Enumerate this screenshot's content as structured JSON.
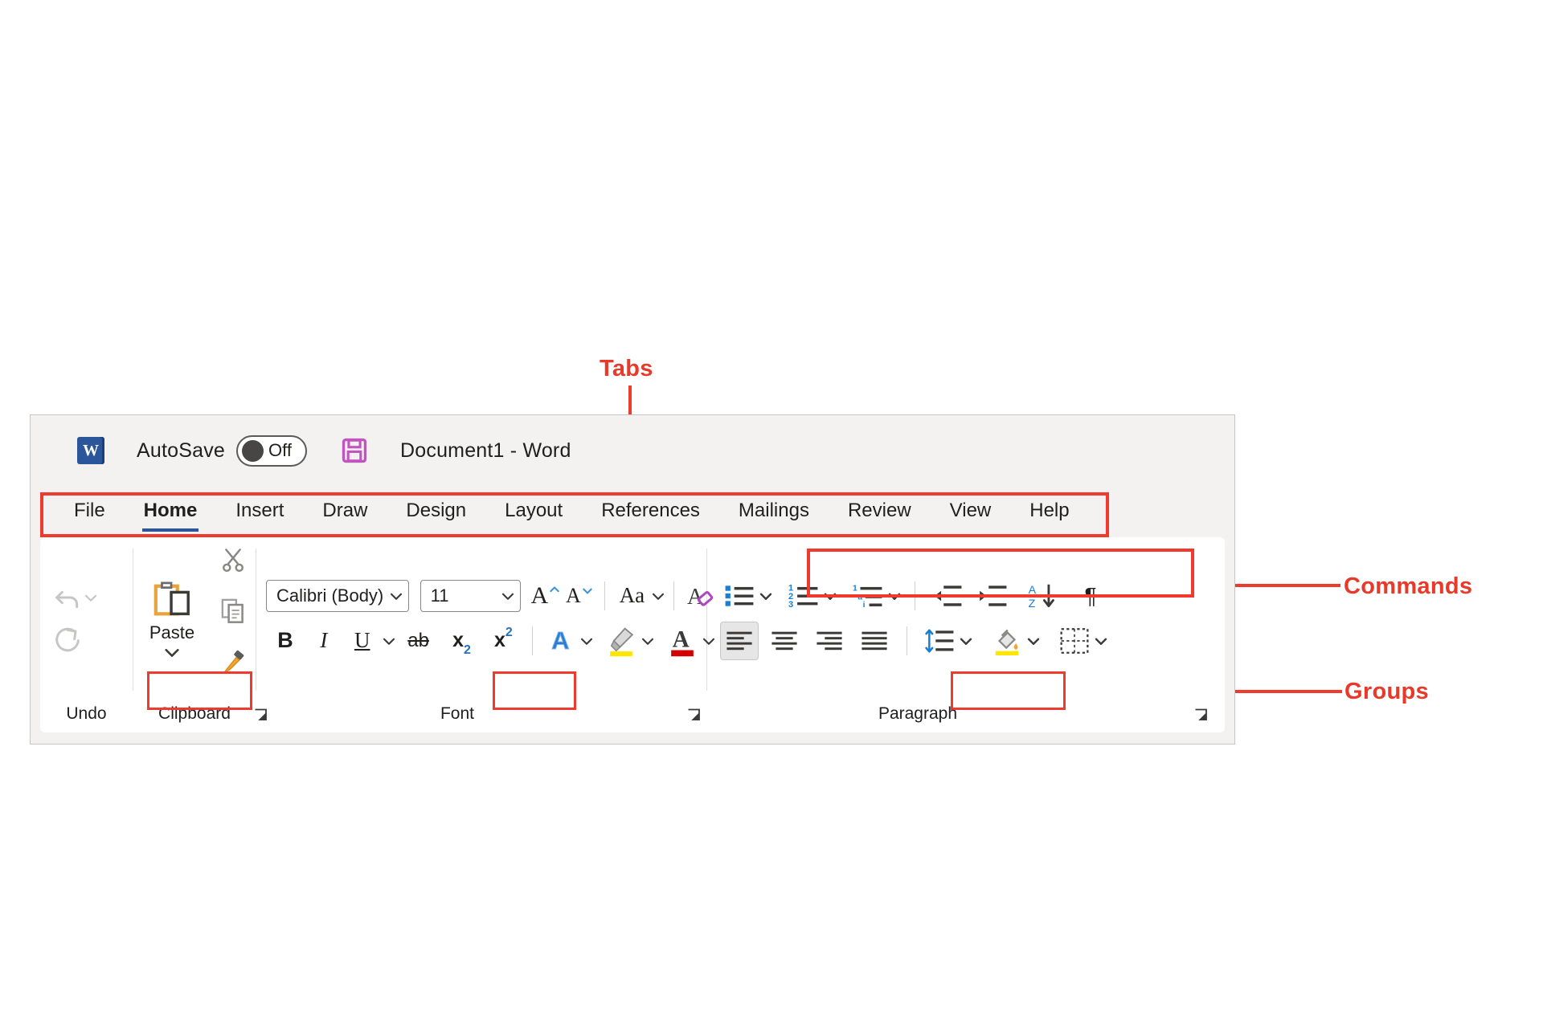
{
  "annotations": {
    "tabs_label": "Tabs",
    "commands_label": "Commands",
    "groups_label": "Groups",
    "accent_color": "#f03a2e"
  },
  "titlebar": {
    "app_icon": "word-logo-icon",
    "autosave_label": "AutoSave",
    "autosave_state": "Off",
    "save_icon": "save-floppy-icon",
    "document_title": "Document1  -  Word"
  },
  "tabs": [
    {
      "label": "File",
      "active": false
    },
    {
      "label": "Home",
      "active": true
    },
    {
      "label": "Insert",
      "active": false
    },
    {
      "label": "Draw",
      "active": false
    },
    {
      "label": "Design",
      "active": false
    },
    {
      "label": "Layout",
      "active": false
    },
    {
      "label": "References",
      "active": false
    },
    {
      "label": "Mailings",
      "active": false
    },
    {
      "label": "Review",
      "active": false
    },
    {
      "label": "View",
      "active": false
    },
    {
      "label": "Help",
      "active": false
    }
  ],
  "groups": {
    "undo": {
      "label": "Undo",
      "commands": [
        {
          "name": "undo-button",
          "icon": "undo-arrow-icon",
          "has_dropdown": true
        },
        {
          "name": "redo-button",
          "icon": "redo-arrow-icon",
          "has_dropdown": false
        }
      ]
    },
    "clipboard": {
      "label": "Clipboard",
      "paste_label": "Paste",
      "commands": [
        {
          "name": "paste-button",
          "icon": "clipboard-paste-icon",
          "has_dropdown": true
        },
        {
          "name": "cut-button",
          "icon": "scissors-icon"
        },
        {
          "name": "copy-button",
          "icon": "copy-pages-icon"
        },
        {
          "name": "format-painter-button",
          "icon": "paintbrush-icon"
        }
      ],
      "has_dialog_launcher": true
    },
    "font": {
      "label": "Font",
      "font_name": "Calibri (Body)",
      "font_size": "11",
      "commands": [
        {
          "name": "grow-font-button",
          "icon": "increase-font-size-icon",
          "glyph": "A"
        },
        {
          "name": "shrink-font-button",
          "icon": "decrease-font-size-icon",
          "glyph": "A"
        },
        {
          "name": "change-case-button",
          "icon": "change-case-icon",
          "glyph": "Aa",
          "has_dropdown": true
        },
        {
          "name": "clear-formatting-button",
          "icon": "clear-formatting-icon",
          "glyph": "A"
        },
        {
          "name": "bold-button",
          "icon": "bold-icon",
          "glyph": "B"
        },
        {
          "name": "italic-button",
          "icon": "italic-icon",
          "glyph": "I"
        },
        {
          "name": "underline-button",
          "icon": "underline-icon",
          "glyph": "U",
          "has_dropdown": true
        },
        {
          "name": "strikethrough-button",
          "icon": "strikethrough-icon",
          "glyph": "ab"
        },
        {
          "name": "subscript-button",
          "icon": "subscript-icon",
          "glyph": "x"
        },
        {
          "name": "superscript-button",
          "icon": "superscript-icon",
          "glyph": "x"
        },
        {
          "name": "text-effects-button",
          "icon": "text-effects-icon",
          "glyph": "A",
          "has_dropdown": true
        },
        {
          "name": "text-highlight-color-button",
          "icon": "highlighter-icon",
          "has_dropdown": true
        },
        {
          "name": "font-color-button",
          "icon": "font-color-icon",
          "has_dropdown": true
        }
      ],
      "has_dialog_launcher": true
    },
    "paragraph": {
      "label": "Paragraph",
      "commands": [
        {
          "name": "bullets-button",
          "icon": "bulleted-list-icon",
          "has_dropdown": true
        },
        {
          "name": "numbering-button",
          "icon": "numbered-list-icon",
          "has_dropdown": true
        },
        {
          "name": "multilevel-list-button",
          "icon": "multilevel-list-icon",
          "has_dropdown": true
        },
        {
          "name": "decrease-indent-button",
          "icon": "decrease-indent-icon"
        },
        {
          "name": "increase-indent-button",
          "icon": "increase-indent-icon"
        },
        {
          "name": "sort-button",
          "icon": "sort-az-icon"
        },
        {
          "name": "show-formatting-marks-button",
          "icon": "pilcrow-icon",
          "glyph": "¶"
        },
        {
          "name": "align-left-button",
          "icon": "align-left-icon",
          "selected": true
        },
        {
          "name": "align-center-button",
          "icon": "align-center-icon"
        },
        {
          "name": "align-right-button",
          "icon": "align-right-icon"
        },
        {
          "name": "justify-button",
          "icon": "justify-icon"
        },
        {
          "name": "line-spacing-button",
          "icon": "line-spacing-icon",
          "has_dropdown": true
        },
        {
          "name": "shading-button",
          "icon": "shading-paint-bucket-icon",
          "has_dropdown": true
        },
        {
          "name": "borders-button",
          "icon": "borders-icon",
          "has_dropdown": true
        }
      ],
      "has_dialog_launcher": true
    }
  }
}
